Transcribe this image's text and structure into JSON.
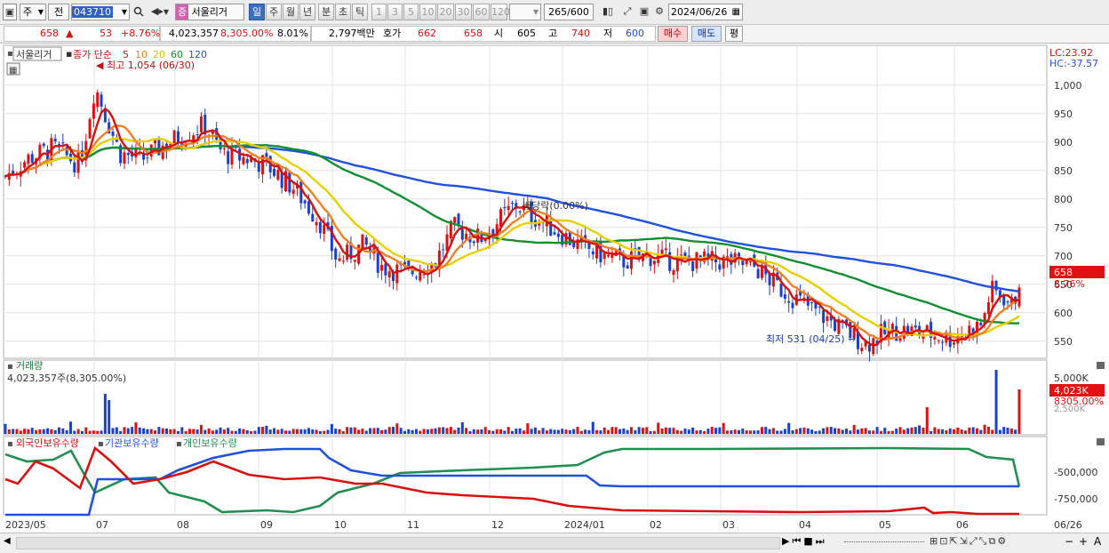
{
  "toolbar": {
    "market": "주",
    "period_label": "전",
    "code": "043710",
    "stock_name": "서울리거",
    "stock_badge": "증",
    "periods": [
      "일",
      "주",
      "월",
      "년",
      "분",
      "초",
      "틱"
    ],
    "active_period": "일",
    "intervals": [
      "1",
      "3",
      "5",
      "10",
      "20",
      "30",
      "60",
      "120"
    ],
    "count": "265",
    "count_total": "/600",
    "date": "2024/06/26"
  },
  "quote": {
    "price": "658",
    "arrow": "▲",
    "change": "53",
    "change_pct": "+8.76%",
    "volume": "4,023,357",
    "volume_pct": "8,305.00%",
    "turnover": "8.01%",
    "amount": "2,797백만",
    "bid_label": "호가",
    "bid1": "662",
    "bid2": "658",
    "open_label": "시",
    "open": "605",
    "high_label": "고",
    "high": "740",
    "low_label": "저",
    "low": "600",
    "buy_label": "매수",
    "sell_label": "매도",
    "eval_label": "평"
  },
  "price_panel": {
    "name_box": "서울리거",
    "legend_prefix": "종가 단순",
    "ma_labels": [
      "5",
      "10",
      "20",
      "60",
      "120"
    ],
    "ma_colors": [
      "#d81010",
      "#f08020",
      "#e8d000",
      "#109030",
      "#2050e0"
    ],
    "hi_note": "최고 1,054 (06/30)",
    "lo_note": "최저 531 (04/25)",
    "div_note": "배당락(0.00%)",
    "lc": "LC:23.92",
    "hc": "HC:-37.57",
    "last_price": "658",
    "last_pct": "8.76%",
    "y_ticks": [
      "1,000",
      "950",
      "900",
      "850",
      "800",
      "750",
      "700",
      "650",
      "600",
      "550"
    ]
  },
  "volume_panel": {
    "title": "거래량",
    "value": "4,023,357주(8,305.00%)",
    "y_tick": "5,000K",
    "y_tick2": "2,500K",
    "last_value": "4,023K",
    "last_pct": "8305.00%"
  },
  "holdings_panel": {
    "series": [
      "외국인보유수량",
      "기관보유수량",
      "개인보유수량"
    ],
    "colors": [
      "#d81010",
      "#2050e0",
      "#209050"
    ],
    "y_ticks": [
      "-500,000",
      "-750,000"
    ]
  },
  "x_axis": {
    "labels": [
      "2023/05",
      "07",
      "08",
      "09",
      "10",
      "11",
      "12",
      "2024/01",
      "02",
      "03",
      "04",
      "05",
      "06"
    ],
    "last": "06/26"
  },
  "chart_data": {
    "type": "candlestick",
    "period": "2023/05 – 2024/06/26",
    "ylim": [
      520,
      1070
    ],
    "ma_periods": [
      5,
      10,
      20,
      60,
      120
    ],
    "monthly_close": [
      {
        "x": "2023/05",
        "y": 840
      },
      {
        "x": "2023/06",
        "y": 880
      },
      {
        "x": "2023/07",
        "y": 880
      },
      {
        "x": "2023/08",
        "y": 920
      },
      {
        "x": "2023/09",
        "y": 850
      },
      {
        "x": "2023/10",
        "y": 690
      },
      {
        "x": "2023/11",
        "y": 670
      },
      {
        "x": "2023/12",
        "y": 770
      },
      {
        "x": "2024/01",
        "y": 720
      },
      {
        "x": "2024/02",
        "y": 690
      },
      {
        "x": "2024/03",
        "y": 680
      },
      {
        "x": "2024/04",
        "y": 560
      },
      {
        "x": "2024/05",
        "y": 560
      },
      {
        "x": "2024/06",
        "y": 658
      }
    ],
    "annotations": {
      "high": 1054,
      "low": 531
    }
  }
}
